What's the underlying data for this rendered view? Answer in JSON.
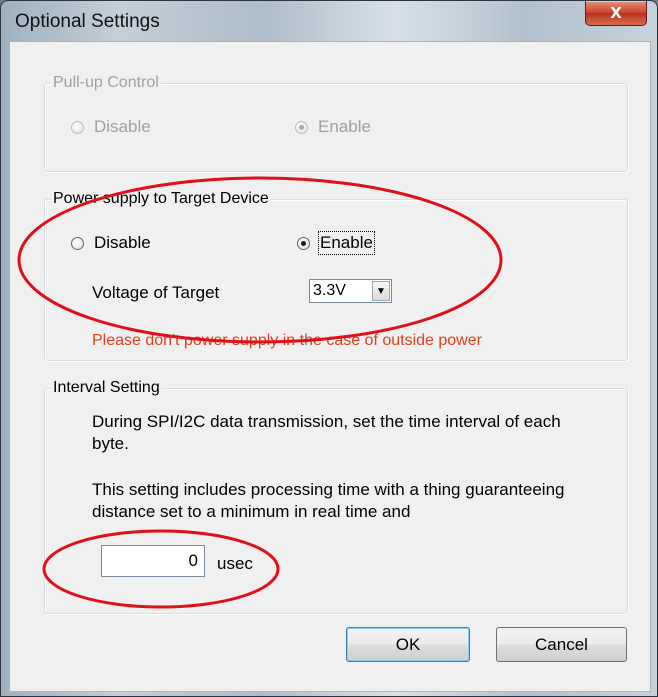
{
  "window": {
    "title": "Optional Settings",
    "close_symbol": "X"
  },
  "pullup": {
    "legend": "Pull-up Control",
    "options": [
      {
        "label": "Disable",
        "selected": false
      },
      {
        "label": "Enable",
        "selected": true
      }
    ],
    "enabled": false
  },
  "power": {
    "legend": "Power supply to Target Device",
    "options": [
      {
        "label": "Disable",
        "selected": false
      },
      {
        "label": "Enable",
        "selected": true
      }
    ],
    "voltage_label": "Voltage of Target",
    "voltage_value": "3.3V",
    "warning": "Please don't power supply in the case of outside power"
  },
  "interval": {
    "legend": "Interval Setting",
    "desc1": "During SPI/I2C data transmission, set the time interval of each byte.",
    "desc2": "This setting includes processing time with a thing guaranteeing distance set to a minimum in real time and",
    "value": "0",
    "unit": "usec"
  },
  "buttons": {
    "ok": "OK",
    "cancel": "Cancel"
  },
  "colors": {
    "warning": "#e0401e",
    "annotation": "#e0101a"
  },
  "icons": {
    "close": "close-icon",
    "dropdown": "chevron-down-icon"
  }
}
